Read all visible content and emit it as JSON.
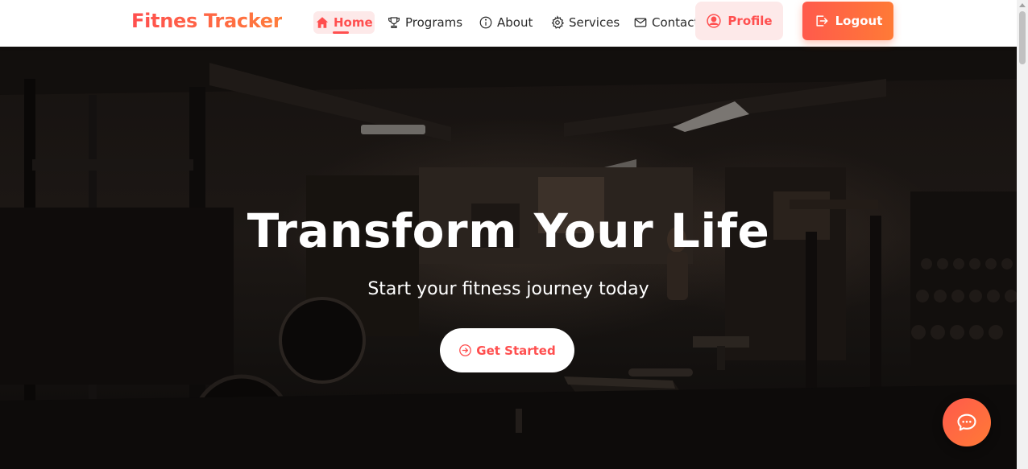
{
  "brand": {
    "name": "Fitnes Tracker"
  },
  "nav": {
    "items": [
      {
        "label": "Home",
        "icon": "home-icon",
        "active": true
      },
      {
        "label": "Programs",
        "icon": "trophy-icon",
        "active": false
      },
      {
        "label": "About",
        "icon": "info-icon",
        "active": false
      },
      {
        "label": "Services",
        "icon": "gear-icon",
        "active": false
      },
      {
        "label": "Contact",
        "icon": "envelope-icon",
        "active": false
      }
    ],
    "profile_label": "Profile",
    "logout_label": "Logout"
  },
  "hero": {
    "title": "Transform Your Life",
    "subtitle": "Start your fitness journey today",
    "cta_label": "Get Started"
  },
  "chat": {
    "icon": "chat-bubble-icon"
  },
  "colors": {
    "accent": "#ff4f4f",
    "accent_gradient_end": "#ff7a36",
    "active_tab_bg": "#fde9e9",
    "hero_bg": "#161210"
  }
}
